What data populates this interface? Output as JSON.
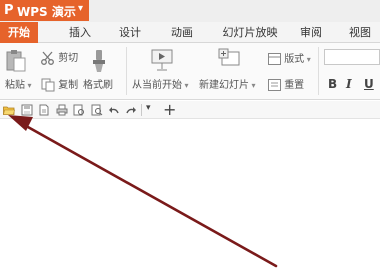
{
  "app": {
    "logo_text": "P",
    "title": "WPS 演示",
    "dropdown_glyph": "▾"
  },
  "tabs": [
    {
      "label": "开始",
      "active": true
    },
    {
      "label": "插入",
      "active": false
    },
    {
      "label": "设计",
      "active": false
    },
    {
      "label": "动画",
      "active": false
    },
    {
      "label": "幻灯片放映",
      "active": false
    },
    {
      "label": "审阅",
      "active": false
    },
    {
      "label": "视图",
      "active": false
    }
  ],
  "ribbon": {
    "paste": "粘贴",
    "cut": "剪切",
    "copy": "复制",
    "format_painter": "格式刷",
    "from_current": "从当前开始",
    "new_slide": "新建幻灯片",
    "layout": "版式",
    "reset": "重置",
    "bold": "B",
    "italic": "I",
    "underline": "U"
  },
  "quick_access": {
    "icons": [
      "open-folder-icon",
      "save-icon",
      "pdf-export-icon",
      "print-icon",
      "print-preview-icon",
      "preview-icon",
      "undo-icon",
      "redo-icon",
      "customize-dropdown-icon",
      "add-icon"
    ],
    "plus_glyph": "+",
    "dropdown_glyph": "▾"
  },
  "colors": {
    "accent": "#e6632b",
    "arrow": "#7a1a1a"
  }
}
